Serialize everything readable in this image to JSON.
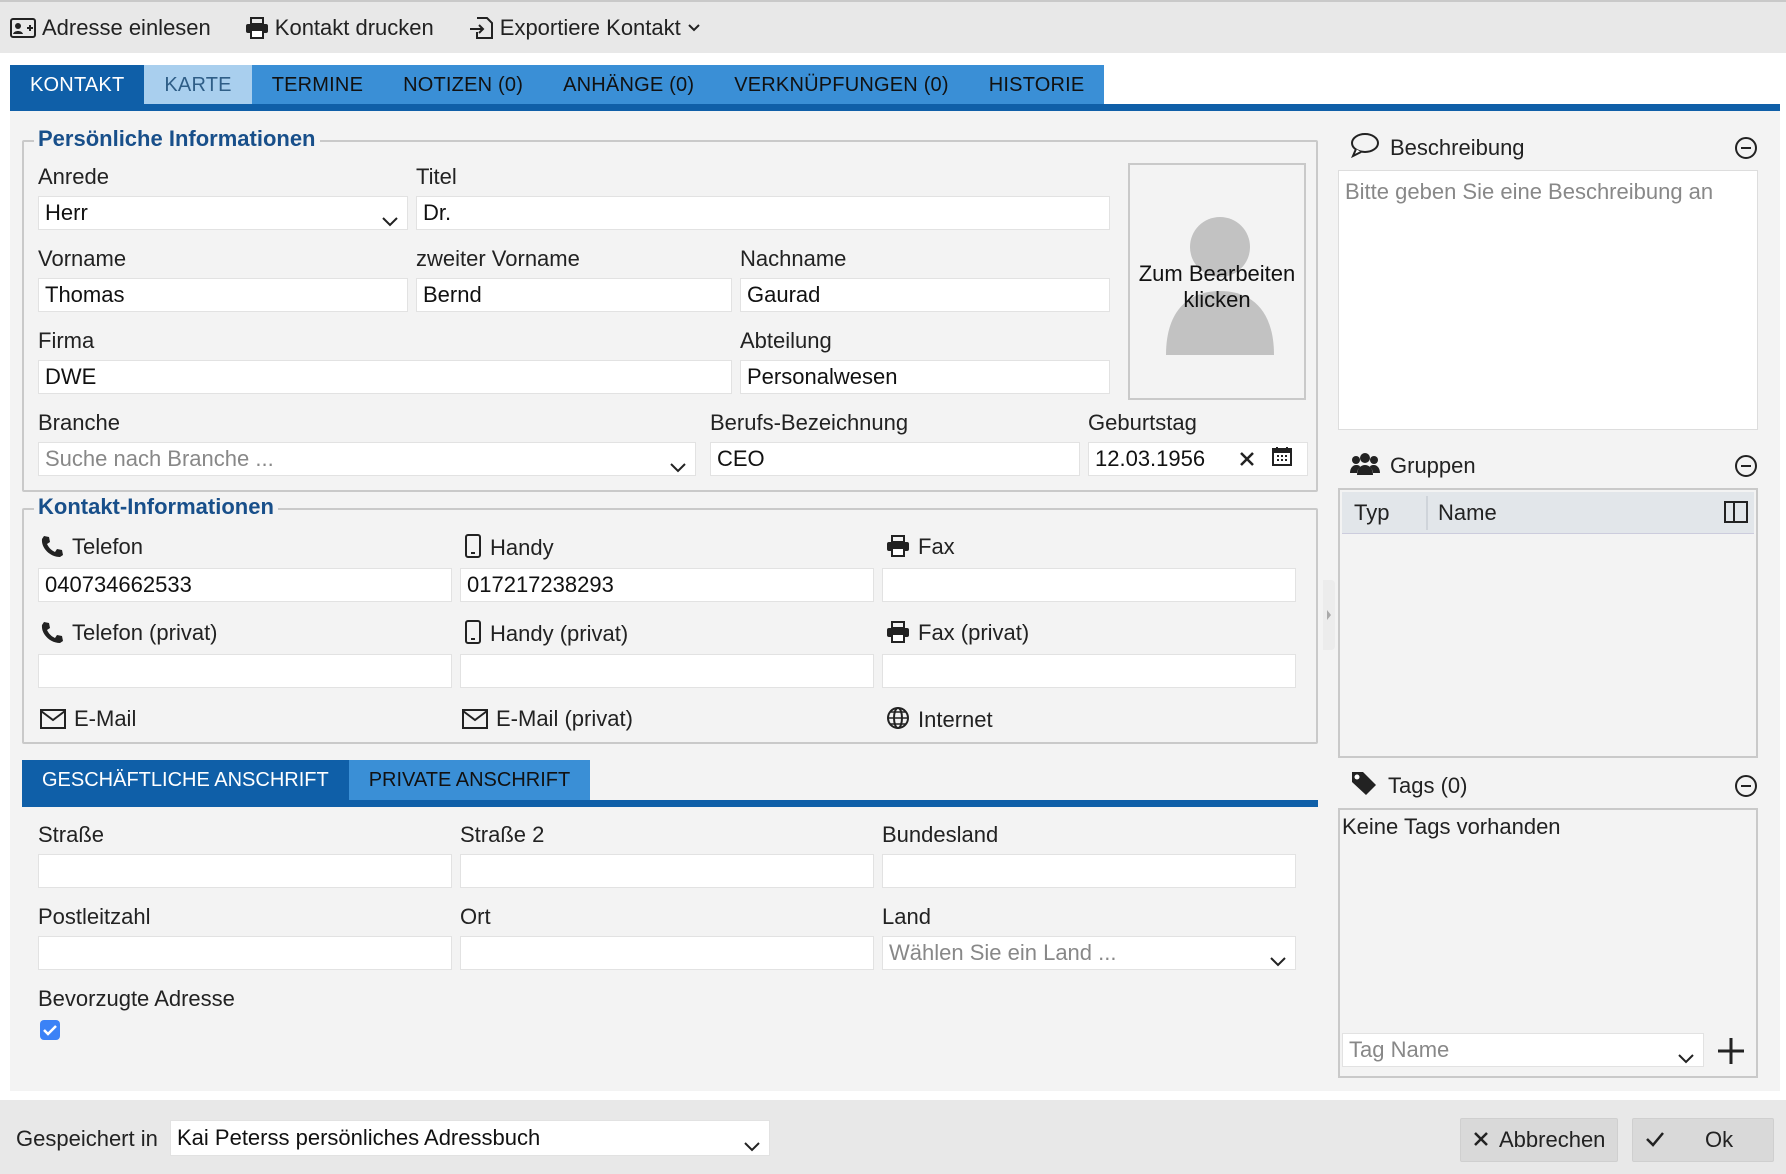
{
  "toolbar": {
    "read_address": "Adresse einlesen",
    "print_contact": "Kontakt drucken",
    "export_contact": "Exportiere Kontakt"
  },
  "tabs": [
    {
      "label": "KONTAKT"
    },
    {
      "label": "KARTE"
    },
    {
      "label": "TERMINE"
    },
    {
      "label": "NOTIZEN (0)"
    },
    {
      "label": "ANHÄNGE (0)"
    },
    {
      "label": "VERKNÜPFUNGEN (0)"
    },
    {
      "label": "HISTORIE"
    }
  ],
  "personal": {
    "legend": "Persönliche Informationen",
    "salutation_label": "Anrede",
    "salutation": "Herr",
    "title_label": "Titel",
    "title": "Dr.",
    "firstname_label": "Vorname",
    "firstname": "Thomas",
    "middlename_label": "zweiter Vorname",
    "middlename": "Bernd",
    "lastname_label": "Nachname",
    "lastname": "Gaurad",
    "company_label": "Firma",
    "company": "DWE",
    "department_label": "Abteilung",
    "department": "Personalwesen",
    "industry_label": "Branche",
    "industry_placeholder": "Suche nach Branche ...",
    "job_label": "Berufs-Bezeichnung",
    "job": "CEO",
    "birthday_label": "Geburtstag",
    "birthday": "12.03.1956",
    "photo_hint": "Zum Bearbeiten klicken"
  },
  "contact": {
    "legend": "Kontakt-Informationen",
    "phone_label": "Telefon",
    "phone": "040734662533",
    "mobile_label": "Handy",
    "mobile": "017217238293",
    "fax_label": "Fax",
    "fax": "",
    "phone_private_label": "Telefon (privat)",
    "phone_private": "",
    "mobile_private_label": "Handy (privat)",
    "mobile_private": "",
    "fax_private_label": "Fax (privat)",
    "fax_private": "",
    "email_label": "E-Mail",
    "email_private_label": "E-Mail (privat)",
    "internet_label": "Internet"
  },
  "address_tabs": [
    {
      "label": "GESCHÄFTLICHE ANSCHRIFT"
    },
    {
      "label": "PRIVATE ANSCHRIFT"
    }
  ],
  "address": {
    "street_label": "Straße",
    "street": "",
    "street2_label": "Straße 2",
    "street2": "",
    "state_label": "Bundesland",
    "state": "",
    "zip_label": "Postleitzahl",
    "zip": "",
    "city_label": "Ort",
    "city": "",
    "country_label": "Land",
    "country_placeholder": "Wählen Sie ein Land ...",
    "preferred_label": "Bevorzugte Adresse",
    "preferred_checked": true
  },
  "description": {
    "title": "Beschreibung",
    "placeholder": "Bitte geben Sie eine Beschreibung an"
  },
  "groups": {
    "title": "Gruppen",
    "col_type": "Typ",
    "col_name": "Name"
  },
  "tags": {
    "title": "Tags (0)",
    "empty": "Keine Tags vorhanden",
    "input_placeholder": "Tag Name"
  },
  "footer": {
    "saved_in_label": "Gespeichert in",
    "saved_in": "Kai Peterss persönliches Adressbuch",
    "cancel": "Abbrechen",
    "ok": "Ok"
  },
  "colors": {
    "tab_active": "#0f5fa8",
    "tab": "#3a8fd6",
    "legend": "#184f8a",
    "checkbox": "#3b82f6"
  }
}
